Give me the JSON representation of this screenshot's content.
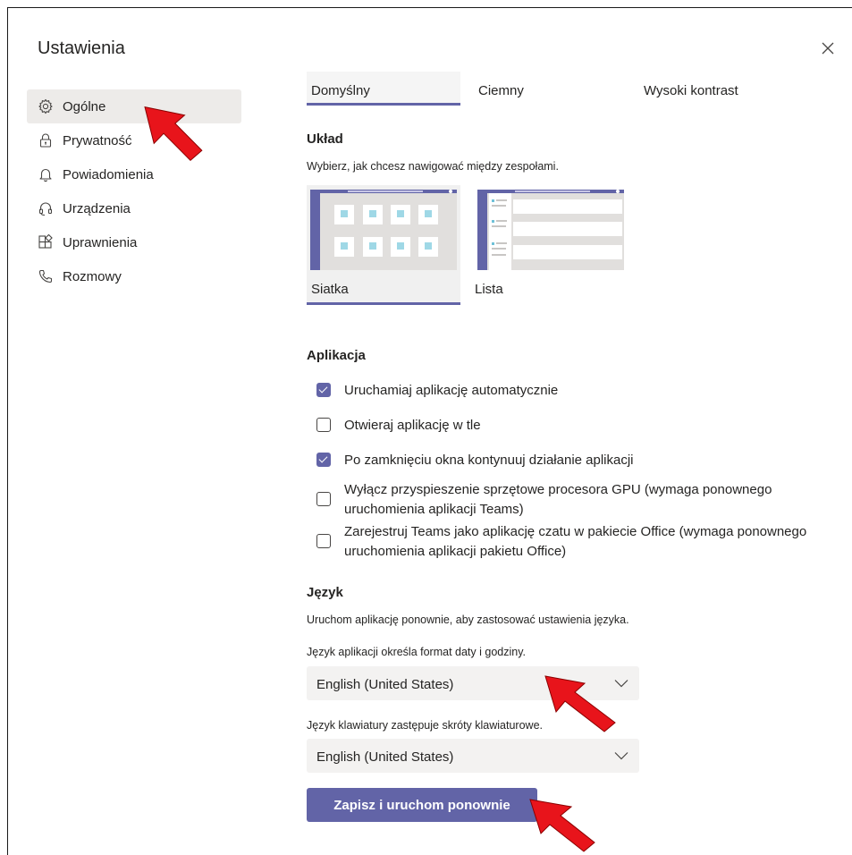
{
  "dialog": {
    "title": "Ustawienia",
    "close_icon": "close-icon"
  },
  "sidebar": {
    "items": [
      {
        "label": "Ogólne",
        "icon": "gear-icon",
        "active": true
      },
      {
        "label": "Prywatność",
        "icon": "lock-icon"
      },
      {
        "label": "Powiadomienia",
        "icon": "bell-icon"
      },
      {
        "label": "Urządzenia",
        "icon": "headset-icon"
      },
      {
        "label": "Uprawnienia",
        "icon": "apps-icon"
      },
      {
        "label": "Rozmowy",
        "icon": "phone-icon"
      }
    ]
  },
  "themes": {
    "options": [
      "Domyślny",
      "Ciemny",
      "Wysoki kontrast"
    ],
    "selected": "Domyślny"
  },
  "layout": {
    "heading": "Układ",
    "description": "Wybierz, jak chcesz nawigować między zespołami.",
    "options": [
      "Siatka",
      "Lista"
    ],
    "selected": "Siatka"
  },
  "app": {
    "heading": "Aplikacja",
    "options": [
      {
        "label": "Uruchamiaj aplikację automatycznie",
        "checked": true
      },
      {
        "label": "Otwieraj aplikację w tle",
        "checked": false
      },
      {
        "label": "Po zamknięciu okna kontynuuj działanie aplikacji",
        "checked": true
      },
      {
        "label": "Wyłącz przyspieszenie sprzętowe procesora GPU (wymaga ponownego uruchomienia aplikacji Teams)",
        "checked": false
      },
      {
        "label": "Zarejestruj Teams jako aplikację czatu w pakiecie Office (wymaga ponownego uruchomienia aplikacji pakietu Office)",
        "checked": false
      }
    ]
  },
  "language": {
    "heading": "Język",
    "description": "Uruchom aplikację ponownie, aby zastosować ustawienia języka.",
    "app_language_label": "Język aplikacji określa format daty i godziny.",
    "app_language_value": "English (United States)",
    "keyboard_language_label": "Język klawiatury zastępuje skróty klawiaturowe.",
    "keyboard_language_value": "English (United States)"
  },
  "actions": {
    "save_restart_label": "Zapisz i uruchom ponownie"
  },
  "colors": {
    "accent": "#6264a7",
    "annotation_arrow": "#e8141b",
    "active_nav_bg": "#edebe9"
  }
}
